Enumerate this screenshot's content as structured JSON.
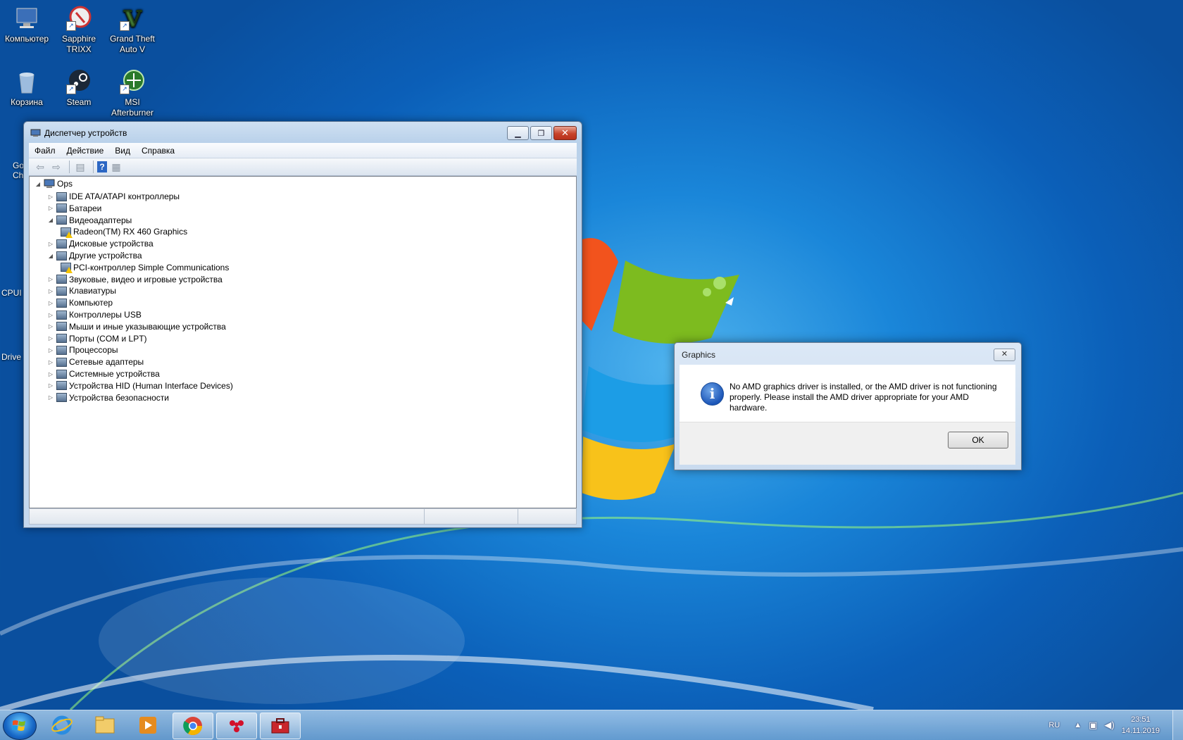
{
  "desktop": {
    "icons": [
      {
        "label": "Компьютер"
      },
      {
        "label": "Sapphire TRIXX"
      },
      {
        "label": "Grand Theft Auto V"
      },
      {
        "label": "Корзина"
      },
      {
        "label": "Steam"
      },
      {
        "label": "MSI Afterburner"
      }
    ],
    "partial_labels": [
      "Go",
      "Ch",
      "CPUI",
      "Drive"
    ]
  },
  "device_manager": {
    "title": "Диспетчер устройств",
    "menu": [
      "Файл",
      "Действие",
      "Вид",
      "Справка"
    ],
    "tree": {
      "root": "Ops",
      "items": [
        {
          "label": "IDE ATA/ATAPI контроллеры",
          "expanded": false
        },
        {
          "label": "Батареи",
          "expanded": false
        },
        {
          "label": "Видеоадаптеры",
          "expanded": true
        },
        {
          "label": "Radeon(TM) RX 460 Graphics",
          "child": true,
          "warning": true
        },
        {
          "label": "Дисковые устройства",
          "expanded": false
        },
        {
          "label": "Другие устройства",
          "expanded": true
        },
        {
          "label": "PCI-контроллер Simple Communications",
          "child": true,
          "warning": true
        },
        {
          "label": "Звуковые, видео и игровые устройства",
          "expanded": false
        },
        {
          "label": "Клавиатуры",
          "expanded": false
        },
        {
          "label": "Компьютер",
          "expanded": false
        },
        {
          "label": "Контроллеры USB",
          "expanded": false
        },
        {
          "label": "Мыши и иные указывающие устройства",
          "expanded": false
        },
        {
          "label": "Порты (COM и LPT)",
          "expanded": false
        },
        {
          "label": "Процессоры",
          "expanded": false
        },
        {
          "label": "Сетевые адаптеры",
          "expanded": false
        },
        {
          "label": "Системные устройства",
          "expanded": false
        },
        {
          "label": "Устройства HID (Human Interface Devices)",
          "expanded": false
        },
        {
          "label": "Устройства безопасности",
          "expanded": false
        }
      ]
    }
  },
  "dialog": {
    "title": "Graphics",
    "message": "No AMD graphics driver is installed, or the AMD driver is not functioning properly. Please install the AMD driver appropriate for your AMD hardware.",
    "ok_label": "OK",
    "icon": "info-icon"
  },
  "taskbar": {
    "apps": [
      "internet-explorer-icon",
      "explorer-icon",
      "media-player-icon",
      "chrome-icon",
      "afterburner-icon",
      "device-manager-icon"
    ],
    "language": "RU",
    "time": "23:51",
    "date": "14.11.2019"
  },
  "colors": {
    "accent": "#1a86d9",
    "warning": "#f5c400",
    "close_button": "#c7432a"
  }
}
